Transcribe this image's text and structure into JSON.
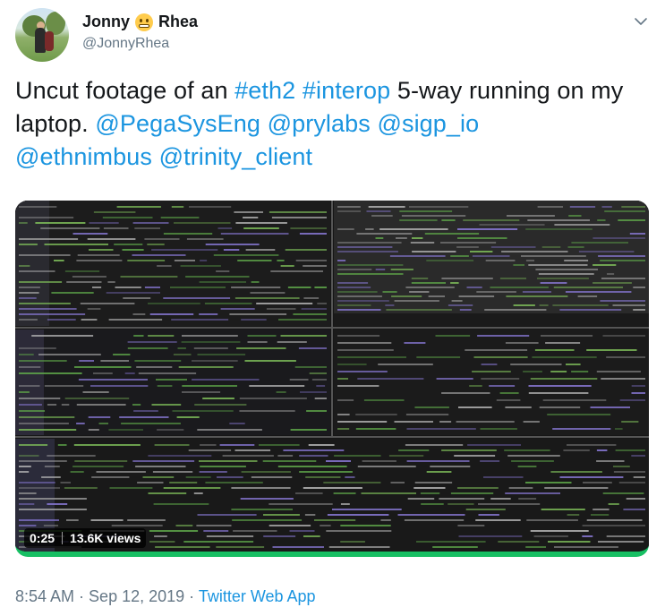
{
  "author": {
    "first_name": "Jonny",
    "last_name": "Rhea",
    "emoji": "grimacing-face-icon",
    "handle": "@JonnyRhea"
  },
  "tweet": {
    "text_1": "Uncut footage of an ",
    "hashtag_1": "#eth2",
    "text_2": " ",
    "hashtag_2": "#interop",
    "text_3": " 5-way running on my laptop.  ",
    "mention_1": "@PegaSysEng",
    "text_4": " ",
    "mention_2": "@prylabs",
    "text_5": " ",
    "mention_3": "@sigp_io",
    "text_6": " ",
    "mention_4": "@ethnimbus",
    "text_7": " ",
    "mention_5": "@trinity_client"
  },
  "video": {
    "duration": "0:25",
    "views": "13.6K views",
    "progress_color": "#17bf63"
  },
  "meta": {
    "time": "8:54 AM",
    "dot_1": " · ",
    "date": "Sep 12, 2019",
    "dot_2": " · ",
    "source": "Twitter Web App"
  },
  "colors": {
    "link": "#1b95e0",
    "secondary": "#657786",
    "text": "#14171a"
  }
}
